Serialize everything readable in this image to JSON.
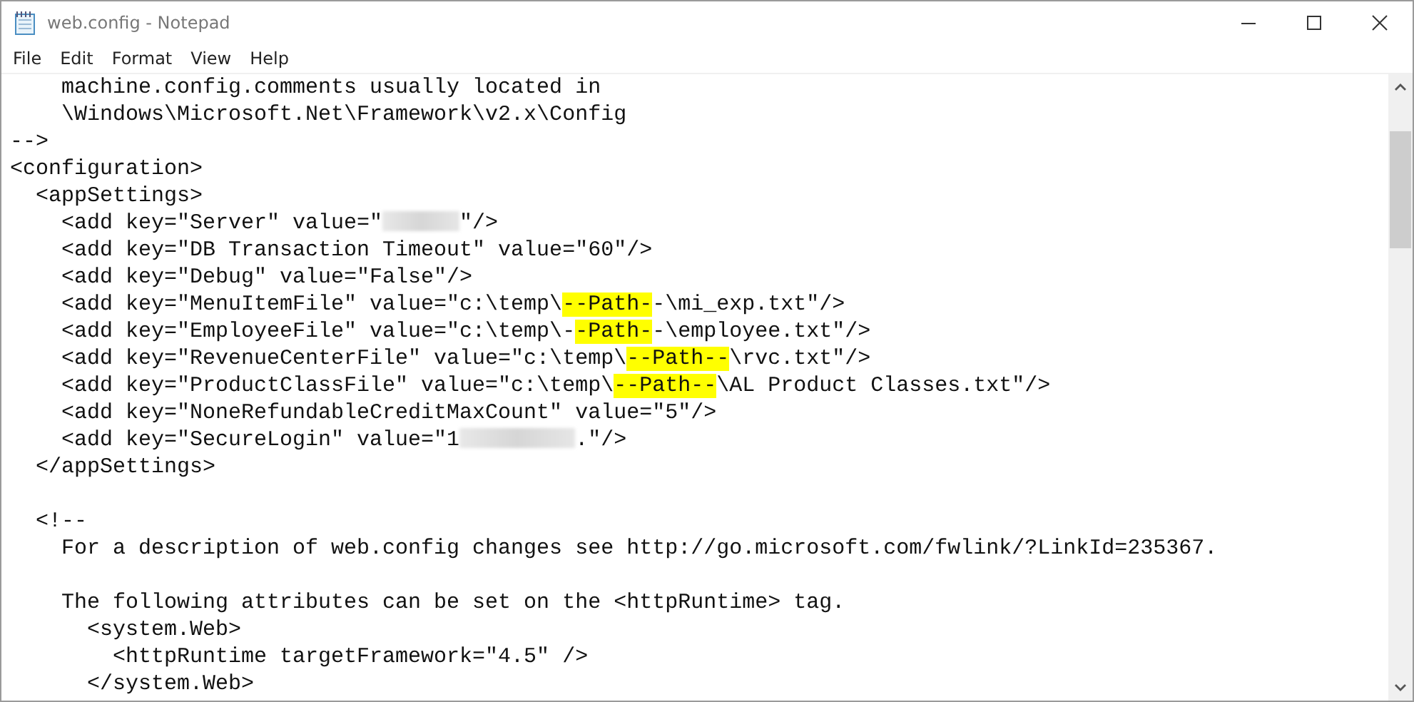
{
  "window": {
    "title": "web.config - Notepad"
  },
  "menu": [
    "File",
    "Edit",
    "Format",
    "View",
    "Help"
  ],
  "lines": [
    {
      "segments": [
        {
          "kind": "text",
          "text": "    machine.config.comments usually located in"
        }
      ]
    },
    {
      "segments": [
        {
          "kind": "text",
          "text": "    \\Windows\\Microsoft.Net\\Framework\\v2.x\\Config"
        }
      ]
    },
    {
      "segments": [
        {
          "kind": "text",
          "text": "-->"
        }
      ]
    },
    {
      "segments": [
        {
          "kind": "text",
          "text": "<configuration>"
        }
      ]
    },
    {
      "segments": [
        {
          "kind": "text",
          "text": "  <appSettings>"
        }
      ]
    },
    {
      "segments": [
        {
          "kind": "text",
          "text": "    <add key=\"Server\" value=\""
        },
        {
          "kind": "redacted_short"
        },
        {
          "kind": "text",
          "text": "\"/>"
        }
      ]
    },
    {
      "segments": [
        {
          "kind": "text",
          "text": "    <add key=\"DB Transaction Timeout\" value=\"60\"/>"
        }
      ]
    },
    {
      "segments": [
        {
          "kind": "text",
          "text": "    <add key=\"Debug\" value=\"False\"/>"
        }
      ]
    },
    {
      "segments": [
        {
          "kind": "text",
          "text": "    <add key=\"MenuItemFile\" value=\"c:\\temp\\"
        },
        {
          "kind": "highlight",
          "text": "--Path-"
        },
        {
          "kind": "text",
          "text": "-\\mi_exp.txt\"/>"
        }
      ]
    },
    {
      "segments": [
        {
          "kind": "text",
          "text": "    <add key=\"EmployeeFile\" value=\"c:\\temp\\-"
        },
        {
          "kind": "highlight",
          "text": "-Path-"
        },
        {
          "kind": "text",
          "text": "-\\employee.txt\"/>"
        }
      ]
    },
    {
      "segments": [
        {
          "kind": "text",
          "text": "    <add key=\"RevenueCenterFile\" value=\"c:\\temp\\"
        },
        {
          "kind": "highlight",
          "text": "--Path--"
        },
        {
          "kind": "text",
          "text": "\\rvc.txt\"/>"
        }
      ]
    },
    {
      "segments": [
        {
          "kind": "text",
          "text": "    <add key=\"ProductClassFile\" value=\"c:\\temp\\"
        },
        {
          "kind": "highlight",
          "text": "--Path--"
        },
        {
          "kind": "text",
          "text": "\\AL Product Classes.txt\"/>"
        }
      ]
    },
    {
      "segments": [
        {
          "kind": "text",
          "text": "    <add key=\"NoneRefundableCreditMaxCount\" value=\"5\"/>"
        }
      ]
    },
    {
      "segments": [
        {
          "kind": "text",
          "text": "    <add key=\"SecureLogin\" value=\"1"
        },
        {
          "kind": "redacted_long"
        },
        {
          "kind": "text",
          "text": ".\"/>"
        }
      ]
    },
    {
      "segments": [
        {
          "kind": "text",
          "text": "  </appSettings>"
        }
      ]
    },
    {
      "kind": "blank"
    },
    {
      "segments": [
        {
          "kind": "text",
          "text": "  <!--"
        }
      ]
    },
    {
      "segments": [
        {
          "kind": "text",
          "text": "    For a description of web.config changes see http://go.microsoft.com/fwlink/?LinkId=235367."
        }
      ]
    },
    {
      "kind": "blank"
    },
    {
      "segments": [
        {
          "kind": "text",
          "text": "    The following attributes can be set on the <httpRuntime> tag."
        }
      ]
    },
    {
      "segments": [
        {
          "kind": "text",
          "text": "      <system.Web>"
        }
      ]
    },
    {
      "segments": [
        {
          "kind": "text",
          "text": "        <httpRuntime targetFramework=\"4.5\" />"
        }
      ]
    },
    {
      "segments": [
        {
          "kind": "text",
          "text": "      </system.Web>"
        }
      ]
    }
  ]
}
